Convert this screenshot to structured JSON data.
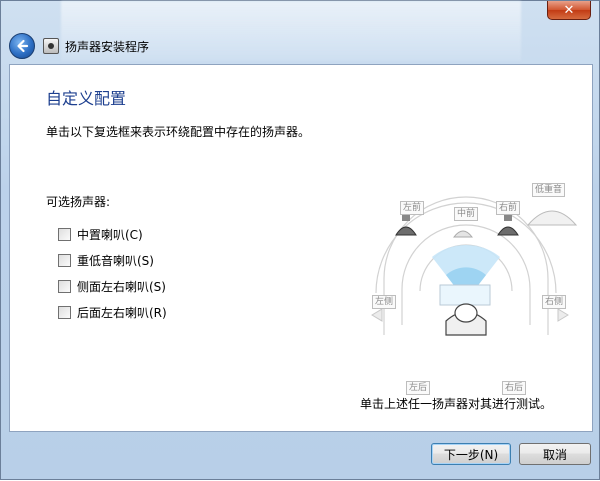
{
  "window": {
    "title": "扬声器安装程序",
    "close_glyph": "✕"
  },
  "content": {
    "page_title": "自定义配置",
    "instruction": "单击以下复选框来表示环绕配置中存在的扬声器。",
    "optional_label": "可选扬声器:",
    "options": [
      {
        "label": "中置喇叭(C)",
        "checked": false
      },
      {
        "label": "重低音喇叭(S)",
        "checked": false
      },
      {
        "label": "侧面左右喇叭(S)",
        "checked": false
      },
      {
        "label": "后面左右喇叭(R)",
        "checked": false
      }
    ],
    "test_hint": "单击上述任一扬声器对其进行测试。"
  },
  "speakers": {
    "front_left": "左前",
    "center": "中前",
    "front_right": "右前",
    "subwoofer": "低重音",
    "side_left": "左侧",
    "side_right": "右侧",
    "rear_left": "左后",
    "rear_right": "右后"
  },
  "buttons": {
    "next": "下一步(N)",
    "cancel": "取消"
  },
  "colors": {
    "title_blue": "#1d3f8f",
    "close_red": "#c23b14",
    "chrome_blue": "#bcd2ea",
    "listening_zone": "#9ed4f2"
  }
}
